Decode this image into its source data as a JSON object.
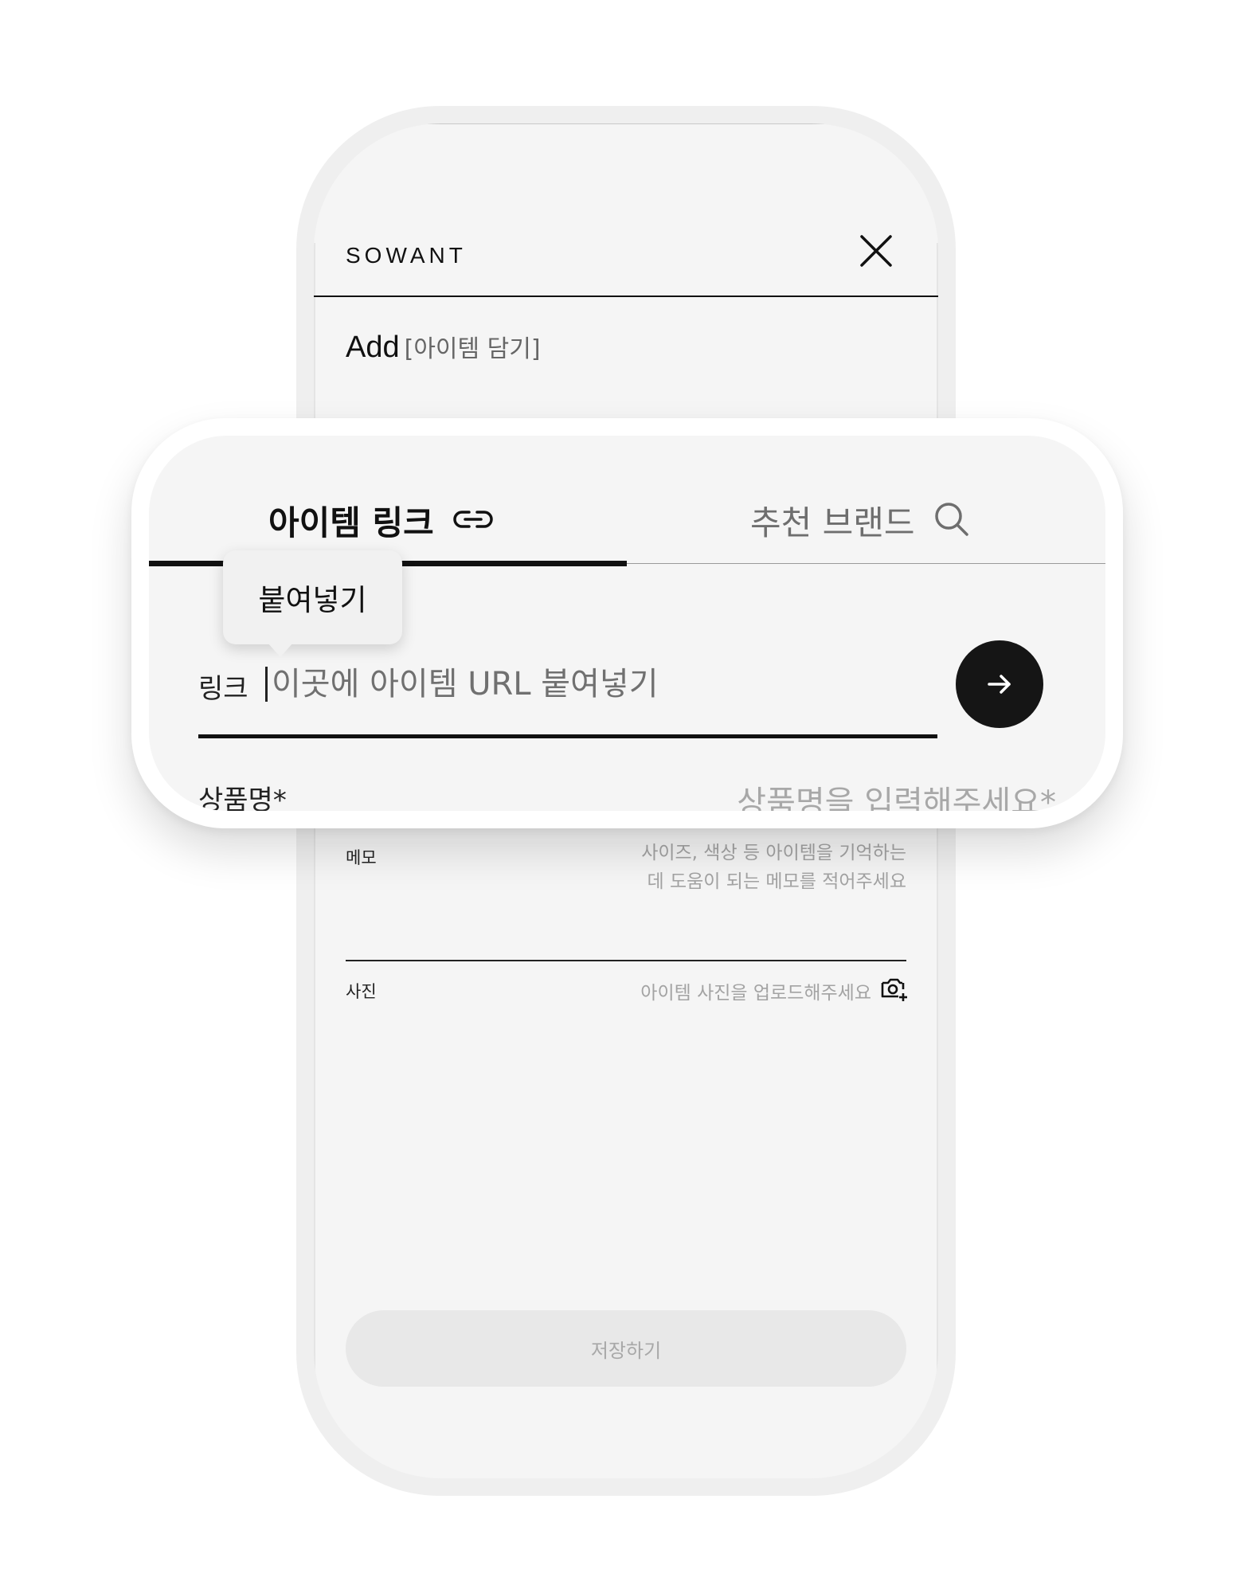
{
  "app": {
    "brand": "SOWANT"
  },
  "page": {
    "title_en": "Add",
    "title_ko": "[아이템 담기]"
  },
  "tabs": [
    {
      "label": "아이템 링크",
      "icon": "link-icon",
      "active": true
    },
    {
      "label": "추천 브랜드",
      "icon": "search-icon",
      "active": false
    }
  ],
  "tooltip": {
    "label": "붙여넣기"
  },
  "link_field": {
    "label": "링크",
    "placeholder": "이곳에 아이템 URL 붙여넣기",
    "value": ""
  },
  "product_name": {
    "label": "상품명*",
    "placeholder": "상품명을 입력해주세요*"
  },
  "memo": {
    "label": "메모",
    "placeholder_line1": "사이즈, 색상 등 아이템을 기억하는",
    "placeholder_line2": "데 도움이 되는 메모를 적어주세요"
  },
  "photo": {
    "label": "사진",
    "placeholder": "아이템 사진을 업로드해주세요",
    "icon": "camera-plus-icon"
  },
  "save_button": {
    "label": "저장하기"
  },
  "icons": {
    "close": "close-icon",
    "submit": "arrow-right-icon"
  },
  "colors": {
    "text_primary": "#111111",
    "text_placeholder": "#a3a3a3",
    "button_dark": "#151515",
    "background": "#f5f5f5",
    "save_disabled": "#e8e8e8"
  }
}
